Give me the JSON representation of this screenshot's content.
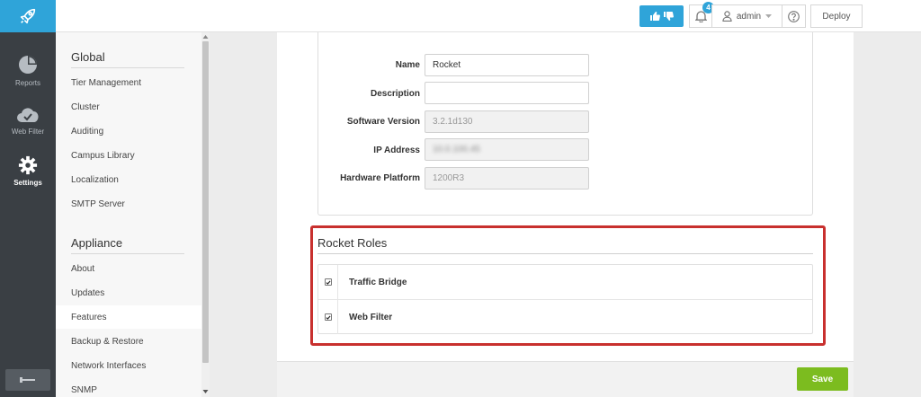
{
  "rail": {
    "items": [
      {
        "label": "Reports",
        "icon": "pie-chart-icon"
      },
      {
        "label": "Web Filter",
        "icon": "cloud-check-icon"
      },
      {
        "label": "Settings",
        "icon": "gear-icon"
      }
    ]
  },
  "topbar": {
    "notification_count": "4",
    "user": "admin",
    "deploy_label": "Deploy"
  },
  "subnav": {
    "sections": [
      {
        "title": "Global",
        "items": [
          "Tier Management",
          "Cluster",
          "Auditing",
          "Campus Library",
          "Localization",
          "SMTP Server"
        ]
      },
      {
        "title": "Appliance",
        "items": [
          "About",
          "Updates",
          "Features",
          "Backup & Restore",
          "Network Interfaces",
          "SNMP"
        ]
      }
    ],
    "active_item": "Features"
  },
  "form": {
    "name_label": "Name",
    "name_value": "Rocket",
    "description_label": "Description",
    "description_value": "",
    "software_version_label": "Software Version",
    "software_version_value": "3.2.1d130",
    "ip_label": "IP Address",
    "ip_value": "10.0.100.45",
    "hardware_label": "Hardware Platform",
    "hardware_value": "1200R3"
  },
  "roles": {
    "title": "Rocket Roles",
    "items": [
      {
        "label": "Traffic Bridge",
        "checked": true
      },
      {
        "label": "Web Filter",
        "checked": true
      }
    ]
  },
  "footer": {
    "save_label": "Save"
  },
  "colors": {
    "accent": "#2fa4d9",
    "save": "#7cbc1f",
    "highlight": "#c8302e",
    "rail": "#3a3f44"
  }
}
